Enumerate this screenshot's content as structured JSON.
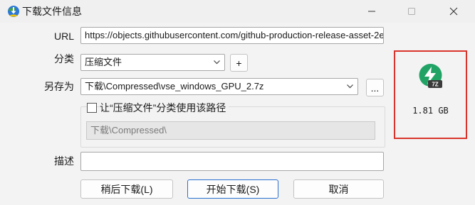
{
  "window": {
    "title": "下载文件信息",
    "colors": {
      "background": "#f3f3f3",
      "accent": "#2a6fd1",
      "highlight_box": "#d9342b"
    }
  },
  "form": {
    "url_label": "URL",
    "url_value": "https://objects.githubusercontent.com/github-production-release-asset-2e",
    "category_label": "分类",
    "category_value": "压缩文件",
    "add_category_label": "+",
    "save_as_label": "另存为",
    "save_as_value": "下载\\Compressed\\vse_windows_GPU_2.7z",
    "browse_label": "...",
    "use_path_checkbox_label": "让“压缩文件”分类使用该路径",
    "use_path_checked": false,
    "category_path_value": "下载\\Compressed\\",
    "description_label": "描述",
    "description_value": ""
  },
  "file_info": {
    "icon": "7z-archive-icon",
    "icon_badge": "7Z",
    "size": "1.81  GB"
  },
  "buttons": {
    "later": "稍后下载(L)",
    "start": "开始下载(S)",
    "cancel": "取消"
  }
}
